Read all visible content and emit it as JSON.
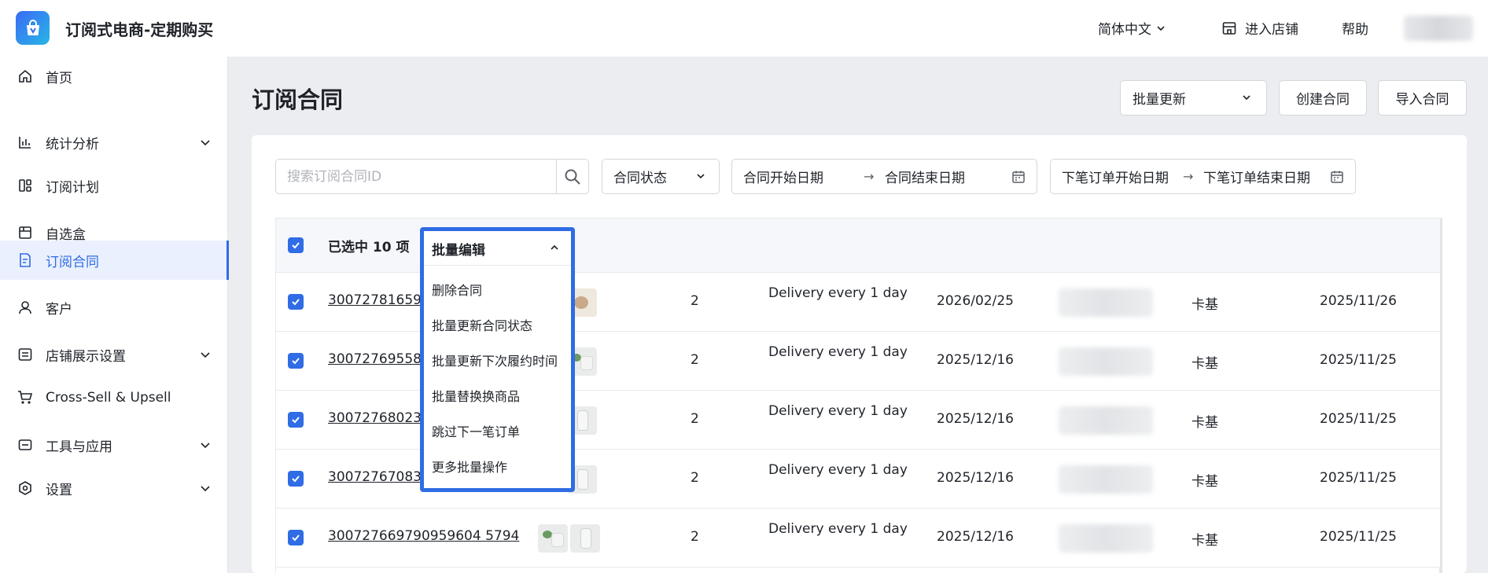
{
  "app": {
    "title": "订阅式电商-定期购买"
  },
  "header": {
    "language": "简体中文",
    "store_link": "进入店铺",
    "help": "帮助"
  },
  "sidebar": {
    "items": [
      {
        "label": "首页",
        "icon": "home-icon",
        "expandable": false,
        "active": false
      },
      {
        "label": "统计分析",
        "icon": "chart-icon",
        "expandable": true,
        "active": false
      },
      {
        "label": "订阅计划",
        "icon": "plan-icon",
        "expandable": false,
        "active": false
      },
      {
        "label": "自选盒",
        "icon": "box-icon",
        "expandable": false,
        "active": false
      },
      {
        "label": "订阅合同",
        "icon": "contract-icon",
        "expandable": false,
        "active": true
      },
      {
        "label": "客户",
        "icon": "user-icon",
        "expandable": false,
        "active": false
      },
      {
        "label": "店铺展示设置",
        "icon": "display-icon",
        "expandable": true,
        "active": false
      },
      {
        "label": "Cross-Sell & Upsell",
        "icon": "cart-icon",
        "expandable": false,
        "active": false
      },
      {
        "label": "工具与应用",
        "icon": "tools-icon",
        "expandable": true,
        "active": false
      },
      {
        "label": "设置",
        "icon": "settings-icon",
        "expandable": true,
        "active": false
      }
    ]
  },
  "page": {
    "title": "订阅合同",
    "actions": {
      "bulk_update": "批量更新",
      "create": "创建合同",
      "import": "导入合同"
    }
  },
  "filters": {
    "search_placeholder": "搜索订阅合同ID",
    "status": "合同状态",
    "contract_start": "合同开始日期",
    "contract_end": "合同结束日期",
    "order_start": "下笔订单开始日期",
    "order_end": "下笔订单结束日期",
    "range_arrow": "→"
  },
  "table": {
    "selected_text": "已选中 10 项",
    "rows": [
      {
        "id": "30072781659",
        "thumbs": [
          "almond"
        ],
        "qty": "2",
        "frequency": "Delivery every 1 day",
        "next_date": "2026/02/25",
        "customer": "卡基",
        "created": "2025/11/26"
      },
      {
        "id": "30072769558",
        "thumbs": [
          "plant"
        ],
        "qty": "2",
        "frequency": "Delivery every 1 day",
        "next_date": "2025/12/16",
        "customer": "卡基",
        "created": "2025/11/25"
      },
      {
        "id": "30072768023",
        "thumbs": [
          "bottle"
        ],
        "qty": "2",
        "frequency": "Delivery every 1 day",
        "next_date": "2025/12/16",
        "customer": "卡基",
        "created": "2025/11/25"
      },
      {
        "id": "30072767083",
        "thumbs": [
          "bottle"
        ],
        "qty": "2",
        "frequency": "Delivery every 1 day",
        "next_date": "2025/12/16",
        "customer": "卡基",
        "created": "2025/11/25"
      },
      {
        "id": "300727669790959604 5794",
        "thumbs": [
          "plant",
          "bottle"
        ],
        "qty": "2",
        "frequency": "Delivery every 1 day",
        "next_date": "2025/12/16",
        "customer": "卡基",
        "created": "2025/11/25"
      }
    ]
  },
  "bulk_edit": {
    "label": "批量编辑",
    "menu": [
      "删除合同",
      "批量更新合同状态",
      "批量更新下次履约时间",
      "批量替换换商品",
      "跳过下一笔订单",
      "更多批量操作"
    ]
  },
  "colors": {
    "accent": "#2f6ce5",
    "background": "#ecedf1"
  }
}
